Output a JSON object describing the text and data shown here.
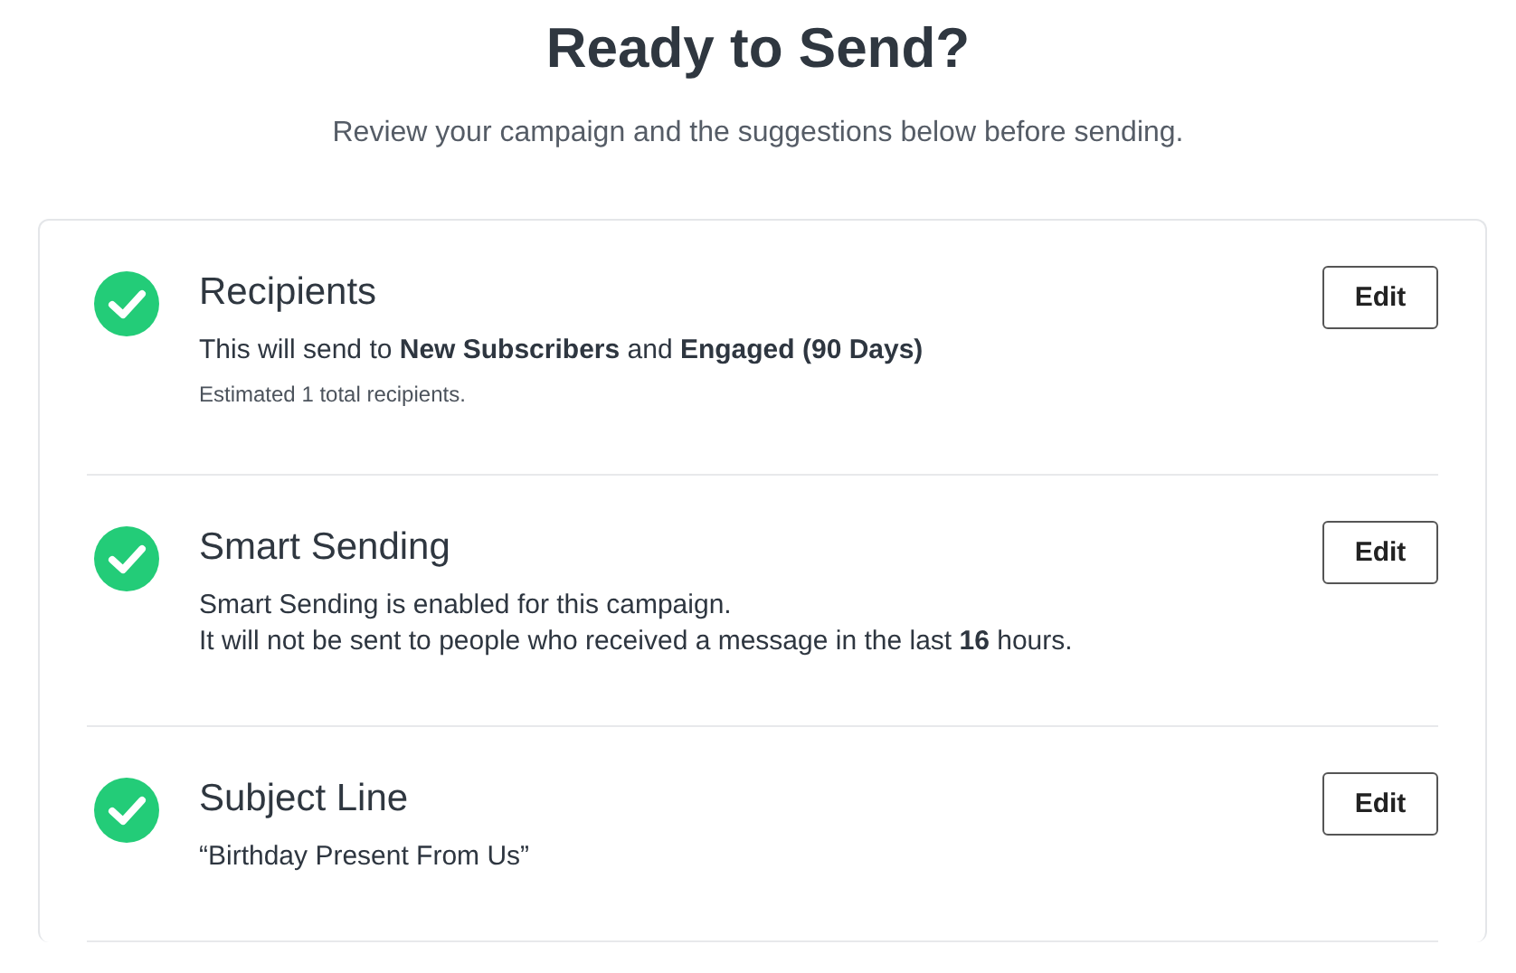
{
  "header": {
    "title": "Ready to Send?",
    "subtitle": "Review your campaign and the suggestions below before sending."
  },
  "sections": [
    {
      "title": "Recipients",
      "done": true,
      "lines": [
        "This will send to **New Subscribers** and **Engaged (90 Days)**"
      ],
      "note": "Estimated 1 total recipients.",
      "action": "Edit"
    },
    {
      "title": "Smart Sending",
      "done": true,
      "lines": [
        "Smart Sending is enabled for this campaign.",
        "It will not be sent to people who received a message in the last **16** hours."
      ],
      "action": "Edit"
    },
    {
      "title": "Subject Line",
      "done": true,
      "lines": [
        "“Birthday Present From Us”"
      ],
      "action": "Edit"
    }
  ]
}
